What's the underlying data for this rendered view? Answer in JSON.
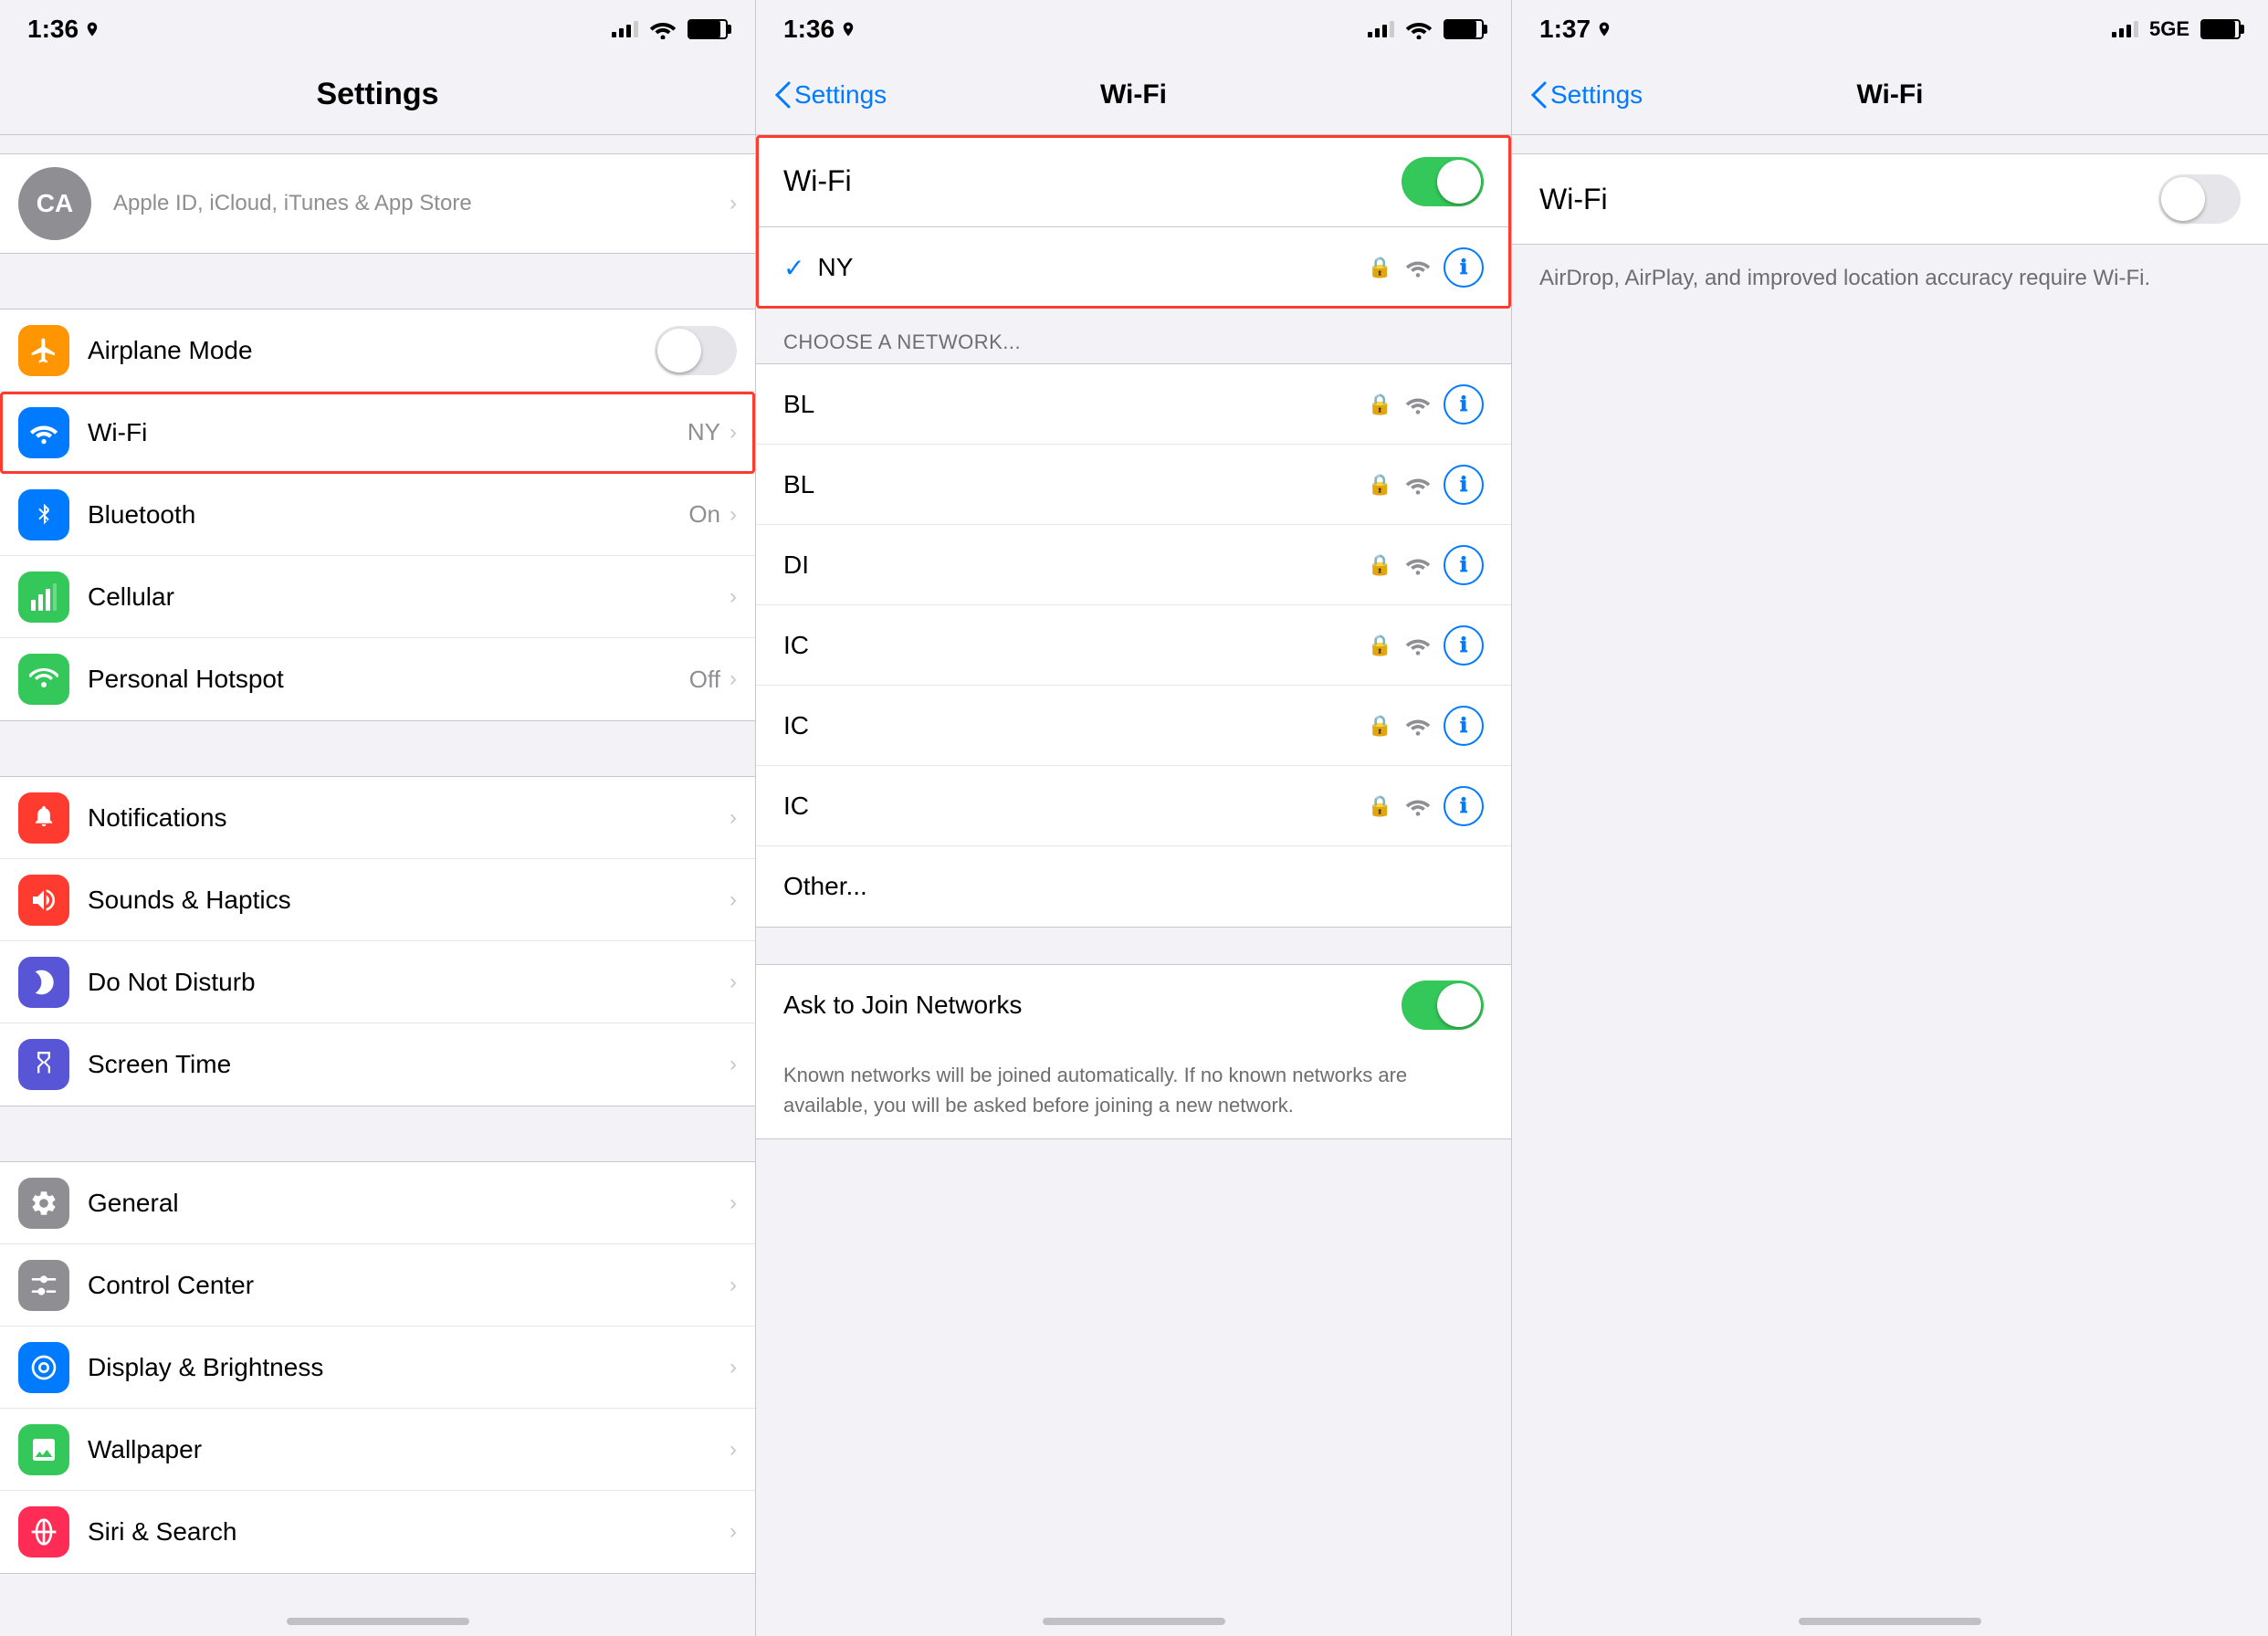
{
  "panels": {
    "left": {
      "statusBar": {
        "time": "1:36",
        "hasLocation": true,
        "signalBars": 3,
        "hasWifi": true,
        "batteryLevel": 85
      },
      "navTitle": "Settings",
      "userProfile": {
        "initials": "CA",
        "subtitle": "Apple ID, iCloud, iTunes & App Store"
      },
      "sections": [
        {
          "items": [
            {
              "id": "airplane",
              "label": "Airplane Mode",
              "iconBg": "#ff9500",
              "iconColor": "#fff",
              "iconType": "airplane",
              "hasToggle": true,
              "toggleOn": false
            },
            {
              "id": "wifi",
              "label": "Wi-Fi",
              "value": "NY",
              "iconBg": "#007aff",
              "iconColor": "#fff",
              "iconType": "wifi",
              "hasChevron": true,
              "highlighted": true
            },
            {
              "id": "bluetooth",
              "label": "Bluetooth",
              "value": "On",
              "iconBg": "#007aff",
              "iconColor": "#fff",
              "iconType": "bluetooth",
              "hasChevron": true
            },
            {
              "id": "cellular",
              "label": "Cellular",
              "iconBg": "#34c759",
              "iconColor": "#fff",
              "iconType": "cellular",
              "hasChevron": true
            },
            {
              "id": "hotspot",
              "label": "Personal Hotspot",
              "value": "Off",
              "iconBg": "#34c759",
              "iconColor": "#fff",
              "iconType": "hotspot",
              "hasChevron": true
            }
          ]
        },
        {
          "items": [
            {
              "id": "notifications",
              "label": "Notifications",
              "iconBg": "#ff3b30",
              "iconColor": "#fff",
              "iconType": "notifications",
              "hasChevron": true
            },
            {
              "id": "sounds",
              "label": "Sounds & Haptics",
              "iconBg": "#ff3b30",
              "iconColor": "#fff",
              "iconType": "sounds",
              "hasChevron": true
            },
            {
              "id": "donotdisturb",
              "label": "Do Not Disturb",
              "iconBg": "#5856d6",
              "iconColor": "#fff",
              "iconType": "moon",
              "hasChevron": true
            },
            {
              "id": "screentime",
              "label": "Screen Time",
              "iconBg": "#5856d6",
              "iconColor": "#fff",
              "iconType": "hourglass",
              "hasChevron": true
            }
          ]
        },
        {
          "items": [
            {
              "id": "general",
              "label": "General",
              "iconBg": "#8e8e93",
              "iconColor": "#fff",
              "iconType": "gear",
              "hasChevron": true
            },
            {
              "id": "controlcenter",
              "label": "Control Center",
              "iconBg": "#8e8e93",
              "iconColor": "#fff",
              "iconType": "switches",
              "hasChevron": true
            },
            {
              "id": "displaybrightness",
              "label": "Display & Brightness",
              "iconBg": "#007aff",
              "iconColor": "#fff",
              "iconType": "display",
              "hasChevron": true
            },
            {
              "id": "wallpaper",
              "label": "Wallpaper",
              "iconBg": "#34c759",
              "iconColor": "#fff",
              "iconType": "photo",
              "hasChevron": true
            },
            {
              "id": "sirigeneral",
              "label": "Siri & Search",
              "iconBg": "#ff2d55",
              "iconColor": "#fff",
              "iconType": "siri",
              "hasChevron": true
            }
          ]
        }
      ]
    },
    "middle": {
      "statusBar": {
        "time": "1:36",
        "hasLocation": true,
        "signalBars": 3,
        "hasWifi": true,
        "batteryLevel": 85
      },
      "navBack": "Settings",
      "navTitle": "Wi-Fi",
      "wifiToggle": {
        "label": "Wi-Fi",
        "on": true,
        "highlighted": true
      },
      "currentNetwork": {
        "name": "NY",
        "hasLock": true,
        "hasWifi": true,
        "hasInfo": true
      },
      "sectionHeader": "CHOOSE A NETWORK...",
      "networks": [
        {
          "name": "BL",
          "hasLock": true,
          "hasWifi": true,
          "hasInfo": true
        },
        {
          "name": "BL",
          "hasLock": true,
          "hasWifi": true,
          "hasInfo": true
        },
        {
          "name": "DI",
          "hasLock": true,
          "hasWifi": true,
          "hasInfo": true
        },
        {
          "name": "IC",
          "hasLock": true,
          "hasWifi": true,
          "hasInfo": true
        },
        {
          "name": "IC",
          "hasLock": true,
          "hasWifi": true,
          "hasInfo": true
        },
        {
          "name": "IC",
          "hasLock": true,
          "hasWifi": true,
          "hasInfo": true
        },
        {
          "name": "Other...",
          "hasLock": false,
          "hasWifi": false,
          "hasInfo": false
        }
      ],
      "askJoin": {
        "label": "Ask to Join Networks",
        "on": true,
        "description": "Known networks will be joined automatically. If no known networks are available, you will be asked before joining a new network."
      }
    },
    "right": {
      "statusBar": {
        "time": "1:37",
        "hasLocation": true,
        "signalBars": 3,
        "has5G": true,
        "batteryLevel": 90
      },
      "navBack": "Settings",
      "navTitle": "Wi-Fi",
      "wifiToggle": {
        "label": "Wi-Fi",
        "on": false
      },
      "infoText": "AirDrop, AirPlay, and improved location accuracy require Wi-Fi."
    }
  }
}
